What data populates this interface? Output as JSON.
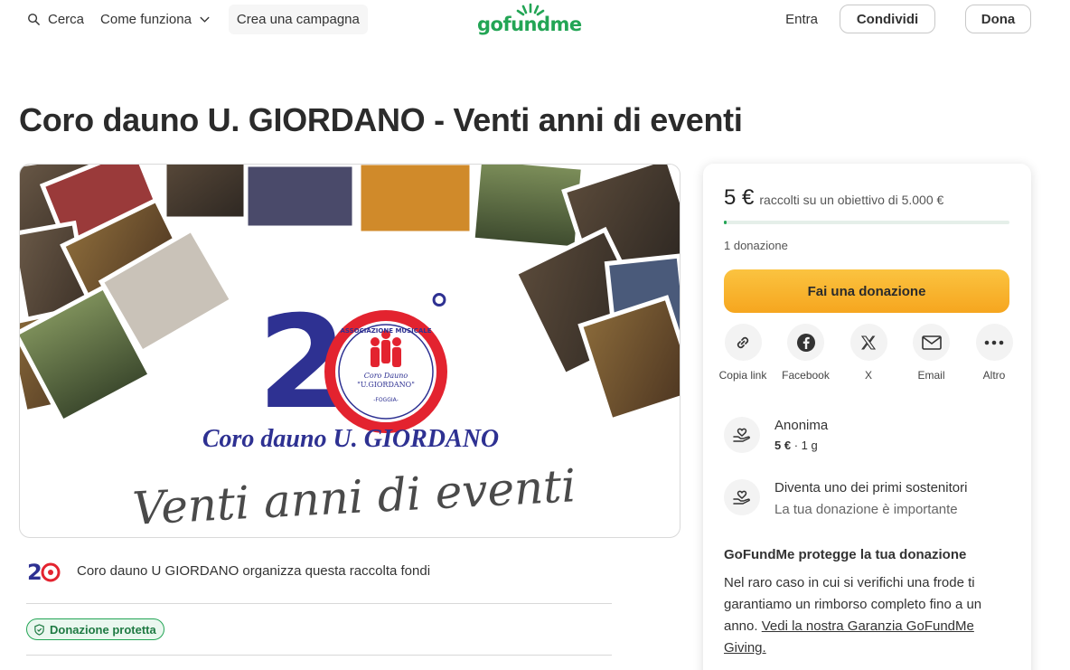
{
  "header": {
    "search_label": "Cerca",
    "how_label": "Come funziona",
    "create_label": "Crea una campagna",
    "logo_text": "gofundme",
    "login_label": "Entra",
    "share_label": "Condividi",
    "donate_label": "Dona"
  },
  "campaign": {
    "title": "Coro dauno U. GIORDANO - Venti anni di eventi",
    "hero": {
      "number": "20",
      "degree": "°",
      "seal_top": "ASSOCIAZIONE MUSICALE",
      "seal_name_1": "Coro Dauno",
      "seal_name_2": "\"U.GIORDANO\"",
      "seal_city": "-FOGGIA-",
      "choir_name": "Coro dauno U. GIORDANO",
      "tagline": "Venti anni di eventi"
    },
    "organizer_text": "Coro dauno U GIORDANO organizza questa raccolta fondi",
    "protected_badge": "Donazione protetta"
  },
  "card": {
    "raised_amount": "5 €",
    "raised_goal": "raccolti su un obiettivo di 5.000 €",
    "progress_fraction": 0.001,
    "donations_count": "1 donazione",
    "donate_button": "Fai una donazione",
    "share": [
      {
        "label": "Copia link",
        "icon": "link-icon"
      },
      {
        "label": "Facebook",
        "icon": "facebook-icon"
      },
      {
        "label": "X",
        "icon": "x-icon"
      },
      {
        "label": "Email",
        "icon": "email-icon"
      },
      {
        "label": "Altro",
        "icon": "more-icon"
      }
    ],
    "feed": [
      {
        "name": "Anonima",
        "amount": "5 €",
        "time": "1 g"
      },
      {
        "name": "Diventa uno dei primi sostenitori",
        "sub": "La tua donazione è importante"
      }
    ],
    "protection": {
      "title": "GoFundMe protegge la tua donazione",
      "text": "Nel raro caso in cui si verifichi una frode ti garantiamo un rimborso completo fino a un anno.",
      "link": "Vedi la nostra Garanzia GoFundMe Giving."
    }
  },
  "colors": {
    "brand_green": "#23a555",
    "donate_orange": "#f6a61f",
    "hero_blue": "#2e3192",
    "hero_red": "#e3232f"
  }
}
